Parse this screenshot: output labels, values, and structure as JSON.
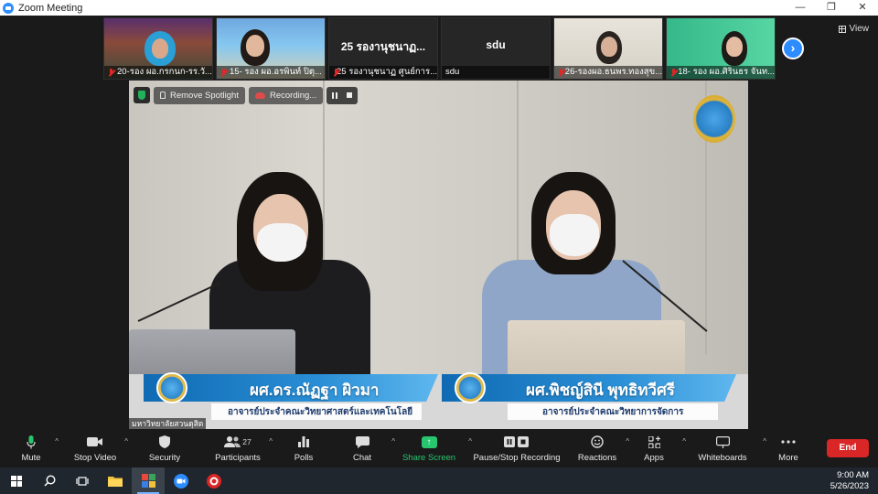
{
  "window": {
    "title": "Zoom Meeting",
    "controls": [
      "—",
      "❐",
      "✕"
    ]
  },
  "participants_strip": [
    {
      "name": "20-รอง ผอ.กรกนก-รร.วั..."
    },
    {
      "name": "15- รอง ผอ.อรพินท์ ปิตุ..."
    },
    {
      "name": "25 รองานุชนาฏ ศูนย์การ...",
      "display": "25 รองานุชนาฏ..."
    },
    {
      "name": "sdu",
      "display": "sdu"
    },
    {
      "name": "26-รองผอ.ธนพร.ทองสุข..."
    },
    {
      "name": "18- รอง ผอ.ศิรินธร จันท..."
    }
  ],
  "view_label": "View",
  "next_icon": "›",
  "overlay": {
    "remove_spotlight": "Remove Spotlight",
    "recording": "Recording..."
  },
  "speakers": [
    {
      "name": "ผศ.ดร.ณัฏฐา ผิวมา",
      "role": "อาจารย์ประจำคณะวิทยาศาสตร์และเทคโนโลยี"
    },
    {
      "name": "ผศ.พิชญ์สินี พุทธิทวีศรี",
      "role": "อาจารย์ประจำคณะวิทยาการจัดการ"
    }
  ],
  "university_label": "มหาวิทยาลัยสวนดุสิต",
  "toolbar": {
    "mute": "Mute",
    "stop_video": "Stop Video",
    "security": "Security",
    "participants": "Participants",
    "participants_count": "27",
    "polls": "Polls",
    "chat": "Chat",
    "share_screen": "Share Screen",
    "pause_stop_recording": "Pause/Stop Recording",
    "reactions": "Reactions",
    "apps": "Apps",
    "whiteboards": "Whiteboards",
    "more": "More",
    "end": "End"
  },
  "taskbar": {
    "time": "9:00 AM",
    "date": "5/26/2023"
  },
  "colors": {
    "zoom_blue": "#2d8cff",
    "end_red": "#d92626",
    "share_green": "#28c76f",
    "lower_third_blue": "#0f6ab3"
  }
}
